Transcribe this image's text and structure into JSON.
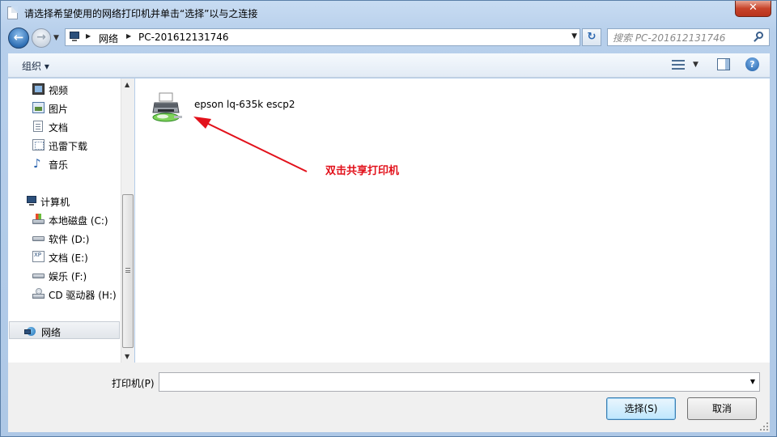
{
  "window": {
    "title": "请选择希望使用的网络打印机并单击“选择”以与之连接",
    "close_label": "✕"
  },
  "address": {
    "segments": [
      "网络",
      "PC-201612131746"
    ]
  },
  "search": {
    "placeholder": "搜索 PC-201612131746"
  },
  "toolbar": {
    "organize_label": "组织 ▾"
  },
  "sidebar": {
    "items": [
      {
        "label": "视频",
        "icon": "video-library-icon"
      },
      {
        "label": "图片",
        "icon": "pictures-library-icon"
      },
      {
        "label": "文档",
        "icon": "documents-library-icon"
      },
      {
        "label": "迅雷下载",
        "icon": "download-folder-icon"
      },
      {
        "label": "音乐",
        "icon": "music-library-icon"
      },
      {
        "label": "计算机",
        "icon": "computer-icon"
      },
      {
        "label": "本地磁盘 (C:)",
        "icon": "system-drive-icon"
      },
      {
        "label": "软件 (D:)",
        "icon": "drive-icon"
      },
      {
        "label": "文档 (E:)",
        "icon": "drive-icon"
      },
      {
        "label": "娱乐 (F:)",
        "icon": "drive-icon"
      },
      {
        "label": "CD 驱动器 (H:)",
        "icon": "cd-drive-icon"
      },
      {
        "label": "网络",
        "icon": "network-icon"
      }
    ]
  },
  "content": {
    "printers": [
      {
        "name": "epson lq-635k escp2",
        "icon": "shared-printer-icon"
      }
    ],
    "annotation": "双击共享打印机",
    "annotation_color": "#e2111b"
  },
  "footer": {
    "printer_label": "打印机(P)",
    "printer_value": "",
    "select_button": "选择(S)",
    "cancel_button": "取消"
  }
}
